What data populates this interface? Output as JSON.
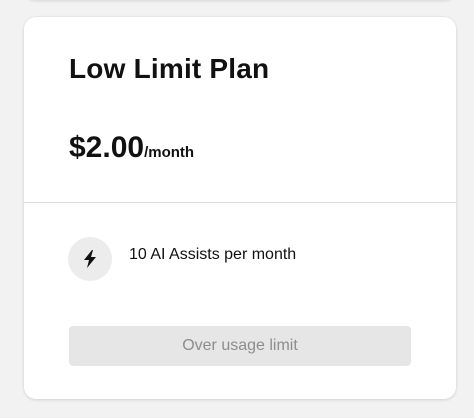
{
  "plan": {
    "name": "Low Limit Plan",
    "price": "$2.00",
    "period": "/month"
  },
  "features": [
    {
      "icon": "lightning-bolt-icon",
      "text": "10 AI Assists per month"
    }
  ],
  "cta": {
    "label": "Over usage limit",
    "disabled": true
  },
  "colors": {
    "card_background": "#ffffff",
    "page_background": "#f2f2f2",
    "button_background": "#e6e6e6",
    "button_text": "#8d8d8d"
  }
}
